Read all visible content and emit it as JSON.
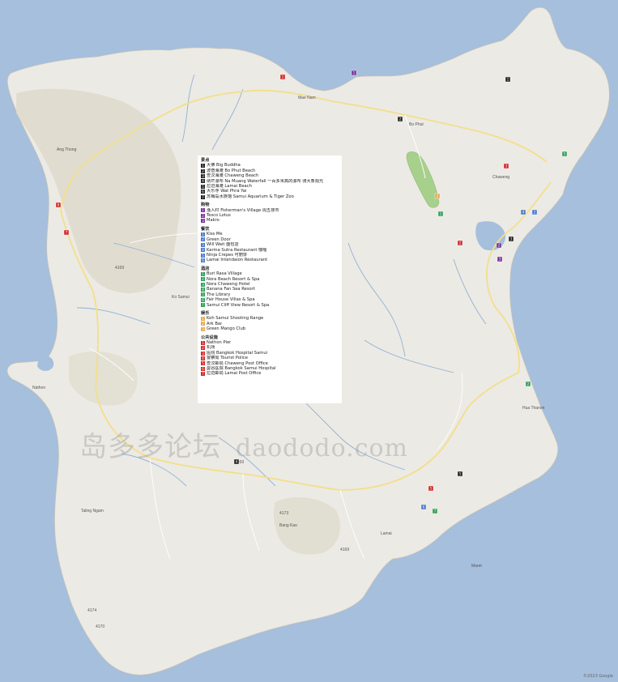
{
  "map": {
    "colors": {
      "sea": "#a5bfdd",
      "land": "#eceae4",
      "hills": "#ddd8ca",
      "park": "#a8d08d",
      "road_major": "#f6e6a0",
      "river": "#8fb2d9"
    },
    "places": [
      {
        "id": "mae-nam",
        "label": "Mae Nam"
      },
      {
        "id": "bo-phut",
        "label": "Bo Phut"
      },
      {
        "id": "ang-thong",
        "label": "Ang Thong"
      },
      {
        "id": "ko-samui",
        "label": "Ko Samui"
      },
      {
        "id": "chaweng",
        "label": "Chaweng"
      },
      {
        "id": "lamai",
        "label": "Lamai"
      },
      {
        "id": "na-thon",
        "label": "Nathon"
      },
      {
        "id": "taling-ngam",
        "label": "Taling Ngam"
      },
      {
        "id": "maret",
        "label": "Maret"
      },
      {
        "id": "bang-kao",
        "label": "Bang Kao"
      },
      {
        "id": "hua-thanon",
        "label": "Hua Thanon"
      }
    ],
    "road_labels": [
      "4169",
      "4169",
      "4170",
      "4173",
      "4174",
      "4169"
    ]
  },
  "legend": {
    "sections": [
      {
        "title": "景点",
        "color": "#222222",
        "items": [
          {
            "num": "1",
            "label": "大佛 Big Buddha"
          },
          {
            "num": "2",
            "label": "波普海滩 Bo Phut Beach"
          },
          {
            "num": "3",
            "label": "查汶海滩 Chaweng Beach"
          },
          {
            "num": "4",
            "label": "纳芒瀑布 Na Muang Waterfall 一百多米高的瀑布 骑大象观光"
          },
          {
            "num": "5",
            "label": "拉迈海滩 Lamai Beach"
          },
          {
            "num": "6",
            "label": "大乐寺 Wat Phra Yai"
          },
          {
            "num": "7",
            "label": "苏梅岛水族馆 Samui Aquarium & Tiger Zoo"
          }
        ]
      },
      {
        "title": "购物",
        "color": "#7a2f9a",
        "items": [
          {
            "num": "1",
            "label": "渔人村 Fisherman's Village 周五夜市"
          },
          {
            "num": "2",
            "label": "Tesco Lotus"
          },
          {
            "num": "3",
            "label": "Makro"
          }
        ]
      },
      {
        "title": "餐饮",
        "color": "#4a78c8",
        "items": [
          {
            "num": "1",
            "label": "Kiss Me"
          },
          {
            "num": "2",
            "label": "Green Door"
          },
          {
            "num": "3",
            "label": "Will Wait 面包店"
          },
          {
            "num": "4",
            "label": "Karma Sutra Restaurant 咖喱"
          },
          {
            "num": "5",
            "label": "Ninja Crepes 可丽饼"
          },
          {
            "num": "6",
            "label": "Lamai Intendaion Restaurant"
          }
        ]
      },
      {
        "title": "酒店",
        "color": "#2e9e5a",
        "items": [
          {
            "num": "1",
            "label": "Buri Rasa Village"
          },
          {
            "num": "2",
            "label": "Nora Beach Resort & Spa"
          },
          {
            "num": "3",
            "label": "Nora Chaweng Hotel"
          },
          {
            "num": "4",
            "label": "Banana Fan Sea Resort"
          },
          {
            "num": "5",
            "label": "The Library"
          },
          {
            "num": "6",
            "label": "Fair House Villas & Spa"
          },
          {
            "num": "7",
            "label": "Samui Cliff View Resort & Spa"
          }
        ]
      },
      {
        "title": "娱乐",
        "color": "#e8a84c",
        "items": [
          {
            "num": "1",
            "label": "Koh Samui Shooting Range"
          },
          {
            "num": "2",
            "label": "Ark Bar"
          },
          {
            "num": "3",
            "label": "Green Mango Club"
          }
        ]
      },
      {
        "title": "公共设施",
        "color": "#d02828",
        "items": [
          {
            "num": "1",
            "label": "Nathon Pier"
          },
          {
            "num": "2",
            "label": "机场"
          },
          {
            "num": "3",
            "label": "医院 Bangkok Hospital Samui"
          },
          {
            "num": "4",
            "label": "警察局 Tourist Police"
          },
          {
            "num": "5",
            "label": "查汶邮局 Chaweng Post Office"
          },
          {
            "num": "6",
            "label": "曼谷医院 Bangkok Samui Hospital"
          },
          {
            "num": "7",
            "label": "拉迈邮局 Lamai Post Office"
          }
        ]
      }
    ]
  },
  "markers": [
    {
      "cat": "public",
      "num": "1"
    },
    {
      "cat": "shop",
      "num": "1"
    },
    {
      "cat": "shop",
      "num": "2"
    },
    {
      "cat": "sight",
      "num": "1"
    },
    {
      "cat": "sight",
      "num": "2"
    },
    {
      "cat": "public",
      "num": "6"
    },
    {
      "cat": "public",
      "num": "7"
    },
    {
      "cat": "hotel",
      "num": "1"
    },
    {
      "cat": "hotel",
      "num": "5"
    },
    {
      "cat": "fun",
      "num": "2"
    },
    {
      "cat": "food",
      "num": "4"
    },
    {
      "cat": "public",
      "num": "3"
    },
    {
      "cat": "public",
      "num": "2"
    },
    {
      "cat": "sight",
      "num": "3"
    },
    {
      "cat": "shop",
      "num": "3"
    },
    {
      "cat": "food",
      "num": "2"
    },
    {
      "cat": "hotel",
      "num": "2"
    },
    {
      "cat": "sight",
      "num": "4"
    },
    {
      "cat": "public",
      "num": "5"
    },
    {
      "cat": "sight",
      "num": "5"
    },
    {
      "cat": "food",
      "num": "6"
    },
    {
      "cat": "hotel",
      "num": "7"
    }
  ],
  "watermark": {
    "cn": "岛多多论坛",
    "latin": "daododo.com"
  },
  "copyright": "©2023 Google"
}
